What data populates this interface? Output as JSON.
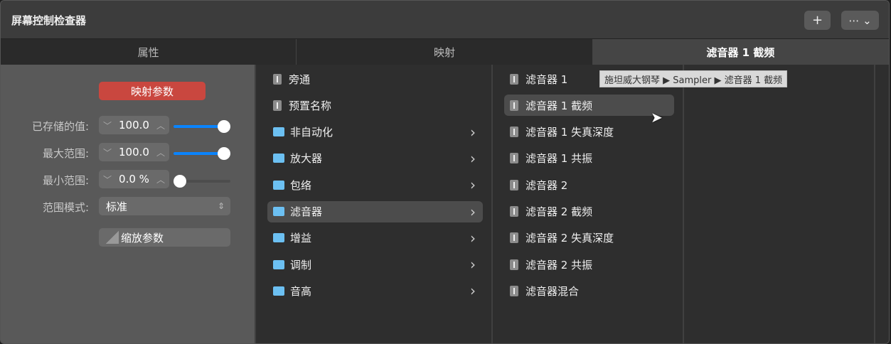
{
  "title": "屏幕控制检查器",
  "toolbar": {
    "add": "+",
    "more": "⋯ ⌄"
  },
  "tabs": [
    "属性",
    "映射",
    "滤音器 1 截频"
  ],
  "left": {
    "map_button": "映射参数",
    "stored_label": "已存储的值:",
    "stored_value": "100.0",
    "stored_level": 1.0,
    "max_label": "最大范围:",
    "max_value": "100.0",
    "max_level": 1.0,
    "min_label": "最小范围:",
    "min_value": "0.0 %",
    "min_level": 0.0,
    "mode_label": "范围模式:",
    "mode_value": "标准",
    "scale_button": "缩放参数"
  },
  "col1": [
    {
      "label": "旁通",
      "type": "param"
    },
    {
      "label": "预置名称",
      "type": "param"
    },
    {
      "label": "非自动化",
      "type": "folder"
    },
    {
      "label": "放大器",
      "type": "folder"
    },
    {
      "label": "包络",
      "type": "folder"
    },
    {
      "label": "滤音器",
      "type": "folder",
      "selected": true
    },
    {
      "label": "增益",
      "type": "folder"
    },
    {
      "label": "调制",
      "type": "folder"
    },
    {
      "label": "音高",
      "type": "folder"
    }
  ],
  "col2": [
    {
      "label": "滤音器 1"
    },
    {
      "label": "滤音器 1 截频",
      "selected": true
    },
    {
      "label": "滤音器 1 失真深度"
    },
    {
      "label": "滤音器 1 共振"
    },
    {
      "label": "滤音器 2"
    },
    {
      "label": "滤音器 2 截频"
    },
    {
      "label": "滤音器 2 失真深度"
    },
    {
      "label": "滤音器 2 共振"
    },
    {
      "label": "滤音器混合"
    }
  ],
  "tooltip": "施坦威大钢琴 ▶ Sampler ▶ 滤音器 1 截频"
}
